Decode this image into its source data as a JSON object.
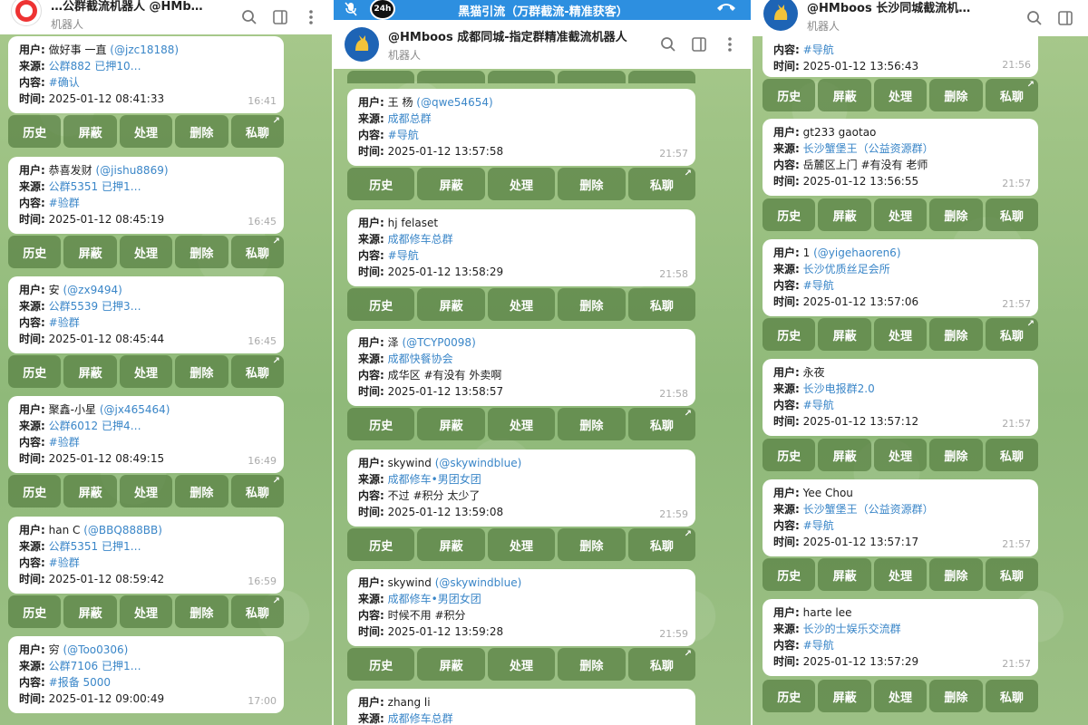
{
  "colors": {
    "accent": "#3a86c8",
    "call_bar": "#2d8fe0",
    "button_bg": "#5b8a44",
    "chat_bg": "#9cbf83"
  },
  "left": {
    "header_title": "…公群截流机器人 @HMb…",
    "header_sub": "机器人",
    "messages": [
      {
        "user": "做好事 一直",
        "handle": "(@jzc18188)",
        "source": "公群882 已押10…",
        "content": "#确认",
        "time_full": "2025-01-12 08:41:33",
        "time": "16:41"
      },
      {
        "user": "恭喜发财",
        "handle": "(@jishu8869)",
        "source": "公群5351 已押1…",
        "content": "#验群",
        "time_full": "2025-01-12 08:45:19",
        "time": "16:45"
      },
      {
        "user": "安",
        "handle": "(@zx9494)",
        "source": "公群5539 已押3…",
        "content": "#验群",
        "time_full": "2025-01-12 08:45:44",
        "time": "16:45"
      },
      {
        "user": "聚鑫-小星",
        "handle": "(@jx465464)",
        "source": "公群6012 已押4…",
        "content": "#验群",
        "time_full": "2025-01-12 08:49:15",
        "time": "16:49"
      },
      {
        "user": "han C",
        "handle": "(@BBQ888BB)",
        "source": "公群5351 已押1…",
        "content": "#验群",
        "time_full": "2025-01-12 08:59:42",
        "time": "16:59"
      },
      {
        "user": "穷",
        "handle": "(@Too0306)",
        "source": "公群7106 已押1…",
        "content": "#报备 5000",
        "time_full": "2025-01-12 09:00:49",
        "time": "17:00"
      }
    ]
  },
  "mid": {
    "call_bar_text": "黑猫引流（万群截流-精准获客）",
    "call_badge": "24h",
    "header_title": "@HMboos 成都同城-指定群精准截流机器人",
    "header_sub": "机器人",
    "messages": [
      {
        "user": "王 杨",
        "handle": "(@qwe54654)",
        "source": "成都总群",
        "content": "#导航",
        "time_full": "2025-01-12 13:57:58",
        "time": "21:57"
      },
      {
        "user": "hj felaset",
        "handle": "",
        "source": "成都修车总群",
        "content": "#导航",
        "time_full": "2025-01-12 13:58:29",
        "time": "21:58"
      },
      {
        "user": "泽",
        "handle": "(@TCYP0098)",
        "source": "成都快餐协会",
        "content": "成华区 #有没有 外卖啊",
        "time_full": "2025-01-12 13:58:57",
        "time": "21:58"
      },
      {
        "user": "skywind",
        "handle": "(@skywindblue)",
        "source": "成都修车•男团女团",
        "content": "不过 #积分 太少了",
        "time_full": "2025-01-12 13:59:08",
        "time": "21:59"
      },
      {
        "user": "skywind",
        "handle": "(@skywindblue)",
        "source": "成都修车•男团女团",
        "content": "时候不用 #积分",
        "time_full": "2025-01-12 13:59:28",
        "time": "21:59"
      },
      {
        "user": "zhang li",
        "handle": "",
        "source": "成都修车总群",
        "content": "",
        "time_full": "",
        "time": ""
      }
    ]
  },
  "right": {
    "header_title": "@HMboos 长沙同城截流机…",
    "header_sub": "机器人",
    "messages": [
      {
        "user": "",
        "handle": "",
        "source": "",
        "content": "#导航",
        "time_full": "2025-01-12 13:56:43",
        "time": "21:56"
      },
      {
        "user": "gt233 gaotao",
        "handle": "",
        "source": "长沙蟹堡王（公益资源群）",
        "content": "岳麓区上门 #有没有 老师",
        "time_full": "2025-01-12 13:56:55",
        "time": "21:57"
      },
      {
        "user": "1",
        "handle": "(@yigehaoren6)",
        "source": "长沙优质丝足会所",
        "content": "#导航",
        "time_full": "2025-01-12 13:57:06",
        "time": "21:57"
      },
      {
        "user": "永夜",
        "handle": "",
        "source": "长沙电报群2.0",
        "content": "#导航",
        "time_full": "2025-01-12 13:57:12",
        "time": "21:57"
      },
      {
        "user": "Yee Chou",
        "handle": "",
        "source": "长沙蟹堡王（公益资源群）",
        "content": "#导航",
        "time_full": "2025-01-12 13:57:17",
        "time": "21:57"
      },
      {
        "user": "harte lee",
        "handle": "",
        "source": "长沙的士娱乐交流群",
        "content": "#导航",
        "time_full": "2025-01-12 13:57:29",
        "time": "21:57"
      }
    ]
  },
  "labels": {
    "user": "用户:",
    "source": "来源:",
    "content": "内容:",
    "time": "时间:"
  },
  "buttons": {
    "history": "历史",
    "block": "屏蔽",
    "handle": "处理",
    "delete": "删除",
    "pm": "私聊"
  }
}
